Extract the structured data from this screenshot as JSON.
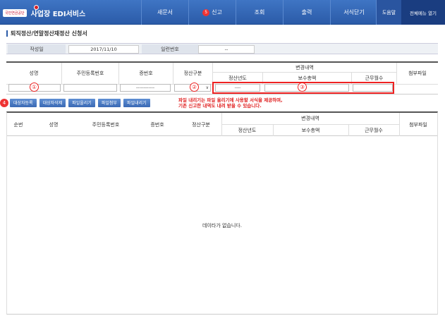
{
  "header": {
    "logo_text": "국민연금공단",
    "app_title": "사업장 EDI서비스",
    "nav": [
      {
        "label": "새문서",
        "badge": ""
      },
      {
        "label": "신고",
        "badge": "5"
      },
      {
        "label": "조회",
        "badge": ""
      },
      {
        "label": "출력",
        "badge": ""
      },
      {
        "label": "서식닫기",
        "badge": ""
      }
    ],
    "help_label": "도움말",
    "allmenu_label": "전체메뉴 열기"
  },
  "page": {
    "title": "퇴직정산/연말정산재정산 신청서"
  },
  "info": {
    "date_label": "작성일",
    "date_value": "2017/11/10",
    "serial_label": "일련번호",
    "serial_value": "--"
  },
  "form": {
    "col_name": "성명",
    "col_rrn": "주민등록번호",
    "col_cert": "증번호",
    "col_type": "정산구분",
    "col_change": "변경내역",
    "col_year": "정산년도",
    "col_salary": "보수총액",
    "col_months": "근무월수",
    "col_attach": "첨부파일",
    "cert_value": "------------",
    "year_value": "----",
    "type_arrow": "∨",
    "marker1": "①",
    "marker2": "②",
    "marker3": "③"
  },
  "actions": {
    "marker4": "4",
    "buttons": [
      "대상자등록",
      "대상자삭제",
      "파일올리기",
      "파일첨부",
      "파일내리기"
    ],
    "notice_line1": "파일 내리기는 파일 올리기에 사용할 서식을 제공하며,",
    "notice_line2": "기존 신고한 내역도 내려 받을 수 있습니다."
  },
  "grid": {
    "col_no": "순번",
    "col_name": "성명",
    "col_rrn": "주민등록번호",
    "col_cert": "증번호",
    "col_type": "정산구분",
    "col_change": "변경내역",
    "col_year": "정산년도",
    "col_salary": "보수총액",
    "col_months": "근무월수",
    "col_attach": "첨부파일",
    "empty_text": "데이타가 없습니다."
  }
}
